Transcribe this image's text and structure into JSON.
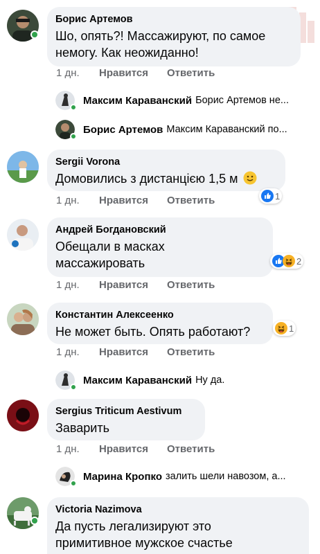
{
  "comments": [
    {
      "author": "Борис Артемов",
      "lines": [
        "Шо, опять?! Массажируют, по самое",
        "немогу. Как неожиданно!"
      ],
      "time": "1 дн.",
      "like": "Нравится",
      "reply": "Ответить"
    },
    {
      "author": "Sergii Vorona",
      "lines": [
        "Домовились з дистанцією 1,5 м"
      ],
      "emoji": "slightly-smiling-face-icon",
      "reactions": {
        "icons": [
          "like-reaction-icon"
        ],
        "count": "1"
      },
      "time": "1 дн.",
      "like": "Нравится",
      "reply": "Ответить"
    },
    {
      "author": "Андрей Богдановский",
      "lines": [
        "Обещали в масках",
        "массажировать"
      ],
      "reactions": {
        "icons": [
          "like-reaction-icon",
          "haha-reaction-icon"
        ],
        "count": "2"
      },
      "time": "1 дн.",
      "like": "Нравится",
      "reply": "Ответить"
    },
    {
      "author": "Константин Алексеенко",
      "lines": [
        "Не может быть. Опять работают?"
      ],
      "reactions": {
        "icons": [
          "haha-reaction-icon"
        ],
        "count": "1"
      },
      "time": "1 дн.",
      "like": "Нравится",
      "reply": "Ответить"
    },
    {
      "author": "Sergius Triticum Aestivum",
      "lines": [
        "Заварить"
      ],
      "time": "1 дн.",
      "like": "Нравится",
      "reply": "Ответить"
    },
    {
      "author": "Victoria Nazimova",
      "lines": [
        "Да пусть легализируют это",
        "примитивное мужское счастье"
      ]
    }
  ],
  "replies": [
    {
      "name": "Максим Караванский",
      "text": "Борис Артемов не..."
    },
    {
      "name": "Борис Артемов",
      "text": "Максим Караванский по..."
    },
    {
      "name": "Максим Караванский",
      "text": "Ну да."
    },
    {
      "name": "Марина Кропко",
      "text": "залить шели навозом, а..."
    }
  ],
  "colors": {
    "bubble": "#f0f2f5",
    "meta_text": "#65676b",
    "online": "#31a24c",
    "like_blue": "#1877f2",
    "haha_yellow": "#f7b125"
  }
}
